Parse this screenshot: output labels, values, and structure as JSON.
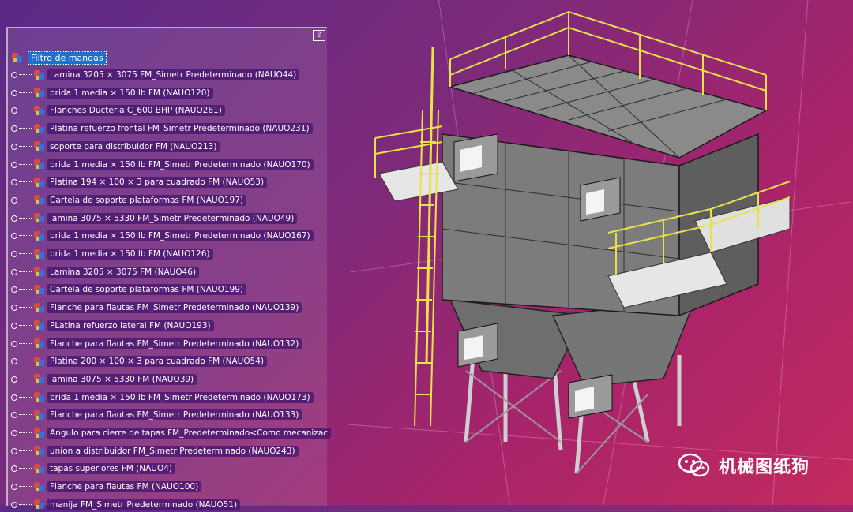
{
  "tree": {
    "root_label": "Filtro de mangas",
    "items": [
      {
        "label": "Lamina 3205 × 3075 FM_Simetr   Predeterminado (NAUO44)"
      },
      {
        "label": "brida 1 media × 150 lb FM (NAUO120)"
      },
      {
        "label": "Flanches Ducteria C_600 BHP (NAUO261)"
      },
      {
        "label": "Platina refuerzo frontal FM_Simetr   Predeterminado (NAUO231)"
      },
      {
        "label": "soporte para distribuidor FM (NAUO213)"
      },
      {
        "label": "brida 1 media × 150 lb FM_Simetr   Predeterminado (NAUO170)"
      },
      {
        "label": "Platina 194 × 100 × 3 para cuadrado FM (NAUO53)"
      },
      {
        "label": "Cartela de soporte plataformas FM (NAUO197)"
      },
      {
        "label": "lamina 3075 × 5330 FM_Simetr   Predeterminado (NAUO49)"
      },
      {
        "label": "brida 1 media × 150 lb FM_Simetr   Predeterminado (NAUO167)"
      },
      {
        "label": "brida 1 media × 150 lb FM (NAUO126)"
      },
      {
        "label": "Lamina 3205 × 3075 FM (NAUO46)"
      },
      {
        "label": "Cartela de soporte plataformas FM (NAUO199)"
      },
      {
        "label": "Flanche para flautas FM_Simetr   Predeterminado (NAUO139)"
      },
      {
        "label": "PLatina refuerzo lateral FM (NAUO193)"
      },
      {
        "label": "Flanche para flautas FM_Simetr   Predeterminado (NAUO132)"
      },
      {
        "label": "Platina 200 × 100 × 3 para cuadrado FM (NAUO54)"
      },
      {
        "label": "lamina 3075 × 5330 FM (NAUO39)"
      },
      {
        "label": "brida 1 media × 150 lb FM_Simetr   Predeterminado (NAUO173)"
      },
      {
        "label": "Flanche para flautas FM_Simetr   Predeterminado (NAUO133)"
      },
      {
        "label": "Angulo para cierre de tapas FM_Predeterminado<Como mecanizac"
      },
      {
        "label": "union a distribuidor FM_Simetr   Predeterminado (NAUO243)"
      },
      {
        "label": "tapas superiores FM (NAUO4)"
      },
      {
        "label": "Flanche para flautas FM (NAUO100)"
      },
      {
        "label": "manija FM_Simetr   Predeterminado (NAUO51)"
      }
    ]
  },
  "watermark": {
    "text": "机械图纸狗",
    "icon": "wechat-icon"
  },
  "colors": {
    "selection": "#1e6fd0",
    "label_bg": "#46146e",
    "structure_gray": "#7a7a7a",
    "railing_yellow": "#e8e24a"
  }
}
